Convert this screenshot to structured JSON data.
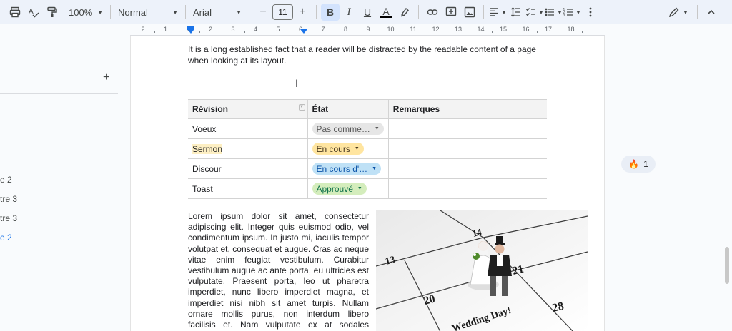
{
  "toolbar": {
    "zoom": "100%",
    "style": "Normal",
    "font": "Arial",
    "font_size": "11",
    "minus": "−",
    "plus": "+",
    "bold": "B",
    "italic": "I",
    "underline": "U",
    "text_color": "A",
    "icons": [
      "print-icon",
      "spellcheck-icon",
      "paint-format-icon",
      "highlighter-icon",
      "link-icon",
      "comment-icon",
      "image-icon",
      "align-icon",
      "line-spacing-icon",
      "checklist-icon",
      "bullet-list-icon",
      "numbered-list-icon",
      "more-icon",
      "edit-mode-icon",
      "collapse-icon"
    ]
  },
  "ruler": {
    "labels": [
      "2",
      "1",
      "1",
      "2",
      "3",
      "4",
      "5",
      "6",
      "7",
      "8",
      "9",
      "10",
      "11",
      "12",
      "13",
      "14",
      "15",
      "16",
      "17",
      "18"
    ]
  },
  "sidebar": {
    "add": "+",
    "items": [
      {
        "label": "e 2",
        "active": false
      },
      {
        "label": "tre 3",
        "active": false
      },
      {
        "label": "tre 3",
        "active": false
      },
      {
        "label": "e 2",
        "active": true
      }
    ]
  },
  "document": {
    "intro": "It is a long established fact that a reader will be distracted by the readable content of a page when looking at its layout.",
    "table": {
      "headers": [
        "Révision",
        "État",
        "Remarques"
      ],
      "rows": [
        {
          "name": "Voeux",
          "status": "Pas comme…",
          "chip": "grey",
          "remarks": ""
        },
        {
          "name": "Sermon",
          "status": "En cours",
          "chip": "yellow",
          "remarks": ""
        },
        {
          "name": "Discour",
          "status": "En cours d'…",
          "chip": "blue",
          "remarks": ""
        },
        {
          "name": "Toast",
          "status": "Approuvé",
          "chip": "green",
          "remarks": ""
        }
      ]
    },
    "lorem": "Lorem ipsum dolor sit amet, consectetur adipiscing elit. Integer quis euismod odio, vel condimentum ipsum. In justo mi, iaculis tempor volutpat et, consequat et augue. Cras ac neque vitae enim feugiat vestibulum. Curabitur vestibulum augue ac ante porta, eu ultricies est vulputate. Praesent porta, leo ut pharetra imperdiet, nunc libero imperdiet magna, et imperdiet nisi nibh sit amet turpis. Nullam ornare mollis purus, non interdum libero facilisis et. Nam vulputate ex at sodales malesuada. Duis",
    "photo": {
      "numbers": [
        "13",
        "14",
        "21",
        "20",
        "28"
      ],
      "caption": "Wedding Day!"
    }
  },
  "reaction": {
    "emoji": "🔥",
    "count": "1"
  }
}
